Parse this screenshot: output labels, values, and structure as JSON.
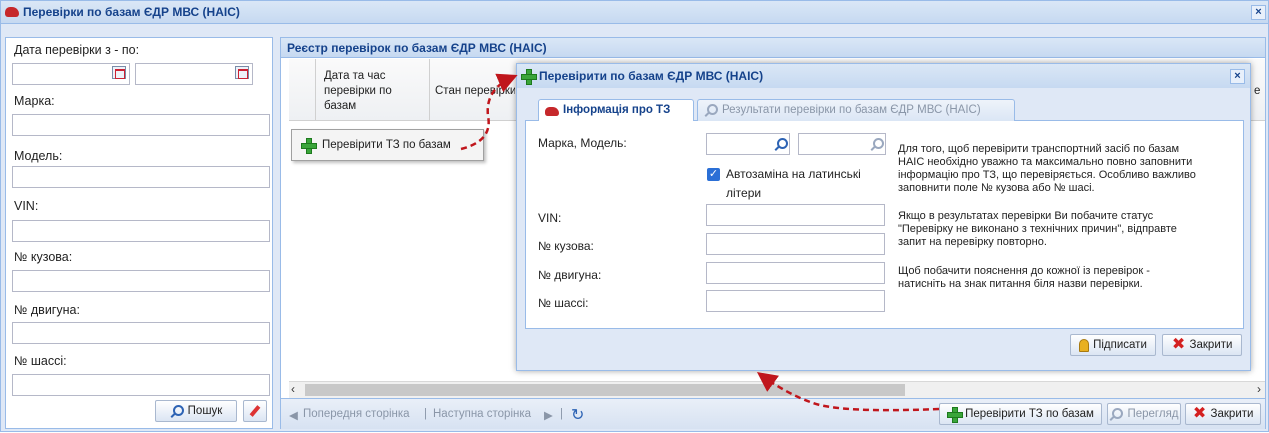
{
  "window": {
    "title": "Перевірки по базам ЄДР МВС (НАІС)",
    "close_icon": "close-icon"
  },
  "filters": {
    "date_label": "Дата перевірки з - по:",
    "brand_label": "Марка:",
    "model_label": "Модель:",
    "vin_label": "VIN:",
    "body_label": "№ кузова:",
    "engine_label": "№ двигуна:",
    "chassis_label": "№ шассі:",
    "search_button": "Пошук"
  },
  "registry": {
    "title": "Реєстр перевірок по базам ЄДР МВС (НАІС)",
    "columns": [
      "Дата та час перевірки по базам",
      "Стан перевірки"
    ],
    "context_menu_item": "Перевірити ТЗ по базам"
  },
  "pager": {
    "prev": "Попередня сторінка",
    "next": "Наступна сторінка",
    "check_button": "Перевірити ТЗ по базам",
    "view_button": "Перегляд",
    "close_button": "Закрити"
  },
  "dialog": {
    "title": "Перевірити по базам ЄДР МВС (НАІС)",
    "tabs": [
      {
        "label": "Інформація про ТЗ",
        "active": true
      },
      {
        "label": "Результати перевірки по базам ЄДР МВС (НАІС)",
        "active": false
      }
    ],
    "fields": {
      "brand_model_label": "Марка, Модель:",
      "autoreplace_label_1": "Автозаміна на латинські",
      "autoreplace_label_2": "літери",
      "autoreplace_checked": true,
      "vin_label": "VIN:",
      "body_label": "№ кузова:",
      "engine_label": "№ двигуна:",
      "chassis_label": "№ шассі:"
    },
    "info": [
      "Для того, щоб перевірити транспортний засіб по базам",
      "НАІС необхідно уважно та максимально повно заповнити",
      "інформацію про ТЗ, що перевіряється. Особливо важливо",
      "заповнити поле № кузова або № шасі.",
      "Якщо в результатах перевірки Ви побачите статус",
      "\"Перевірку не виконано з технічних причин\", відправте",
      "запит на перевірку повторно.",
      "Щоб побачити пояснення до кожної із перевірок -",
      "натисніть на знак питання біля назви перевірки."
    ],
    "sign_button": "Підписати",
    "close_button": "Закрити"
  },
  "colors": {
    "accent": "#15428b",
    "border": "#99bbe8",
    "arrow": "#c0161c"
  }
}
